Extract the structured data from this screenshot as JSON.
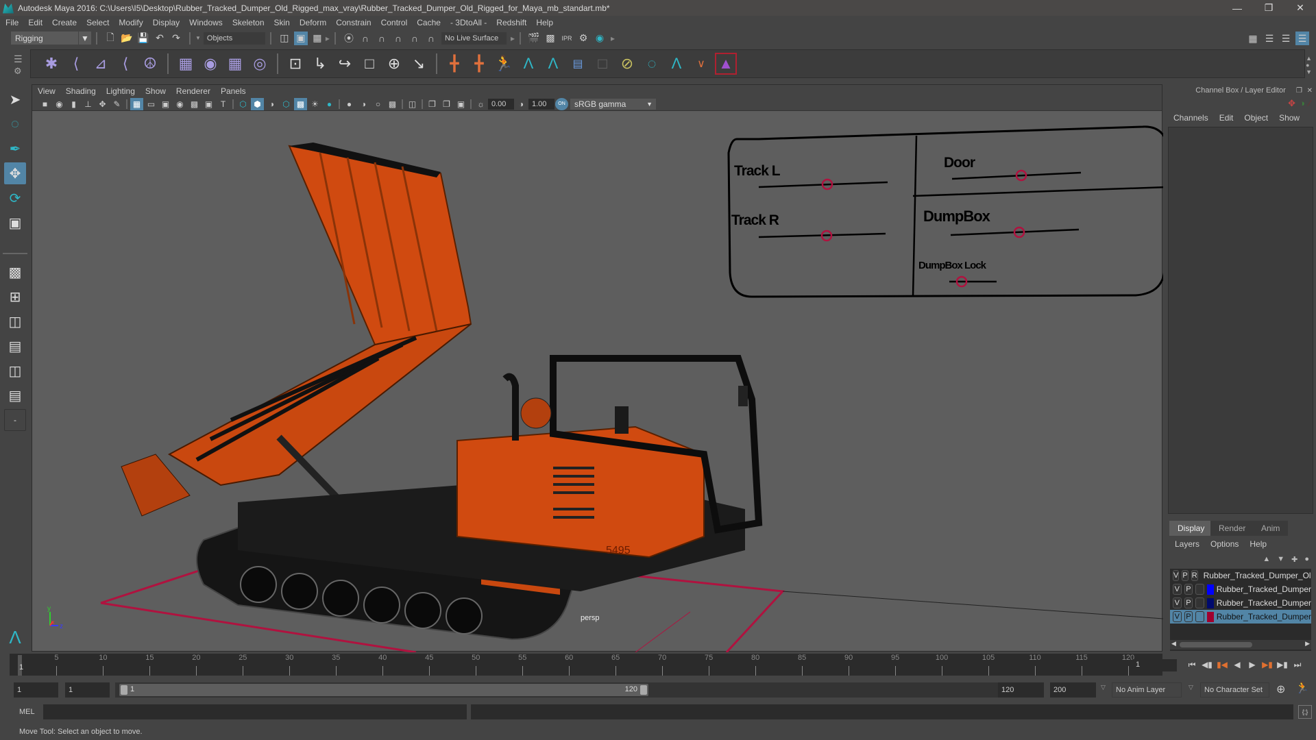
{
  "window": {
    "title": "Autodesk Maya 2016: C:\\Users\\I5\\Desktop\\Rubber_Tracked_Dumper_Old_Rigged_max_vray\\Rubber_Tracked_Dumper_Old_Rigged_for_Maya_mb_standart.mb*",
    "controls": [
      "minimize",
      "restore",
      "close"
    ]
  },
  "menubar": [
    "File",
    "Edit",
    "Create",
    "Select",
    "Modify",
    "Display",
    "Windows",
    "Skeleton",
    "Skin",
    "Deform",
    "Constrain",
    "Control",
    "Cache",
    "- 3DtoAll -",
    "Redshift",
    "Help"
  ],
  "statusline": {
    "menuset": "Rigging",
    "selection_mask": "Objects",
    "live_surface": "No Live Surface"
  },
  "viewport": {
    "menu": [
      "View",
      "Shading",
      "Lighting",
      "Show",
      "Renderer",
      "Panels"
    ],
    "exposure": "0.00",
    "gamma": "1.00",
    "colorspace_toggle": "ON",
    "colorspace": "sRGB gamma",
    "camera_label": "persp",
    "axis_labels": {
      "y": "y",
      "x": "x",
      "z": "z"
    },
    "rig_panel": {
      "labels": [
        "Track L",
        "Track R",
        "Door",
        "DumpBox",
        "DumpBox Lock"
      ],
      "vehicle_number": "5495"
    }
  },
  "channel_box": {
    "title": "Channel Box / Layer Editor",
    "menu": [
      "Channels",
      "Edit",
      "Object",
      "Show"
    ]
  },
  "layer_editor": {
    "tabs": [
      "Display",
      "Render",
      "Anim"
    ],
    "active_tab": "Display",
    "menu": [
      "Layers",
      "Options",
      "Help"
    ],
    "layers": [
      {
        "v": "V",
        "p": "P",
        "r": "R",
        "color": "#0a4a1e",
        "name": "Rubber_Tracked_Dumper_Old",
        "selected": false
      },
      {
        "v": "V",
        "p": "P",
        "r": "",
        "color": "#0000ff",
        "name": "Rubber_Tracked_Dumper",
        "selected": false
      },
      {
        "v": "V",
        "p": "P",
        "r": "",
        "color": "#000a6e",
        "name": "Rubber_Tracked_Dumper",
        "selected": false
      },
      {
        "v": "V",
        "p": "P",
        "r": "",
        "color": "#a0002e",
        "name": "Rubber_Tracked_Dumper",
        "selected": true
      }
    ]
  },
  "timeline": {
    "ticks": [
      5,
      10,
      15,
      20,
      25,
      30,
      35,
      40,
      45,
      50,
      55,
      60,
      65,
      70,
      75,
      80,
      85,
      90,
      95,
      100,
      105,
      110,
      115,
      120
    ],
    "current_frame_marker": "1",
    "current_frame": "1"
  },
  "range": {
    "start": "1",
    "playback_start": "1",
    "slider_start": "1",
    "slider_end": "120",
    "playback_end": "120",
    "end": "200",
    "anim_layer": "No Anim Layer",
    "character_set": "No Character Set"
  },
  "command_line": {
    "label": "MEL"
  },
  "help_line": "Move Tool: Select an object to move."
}
